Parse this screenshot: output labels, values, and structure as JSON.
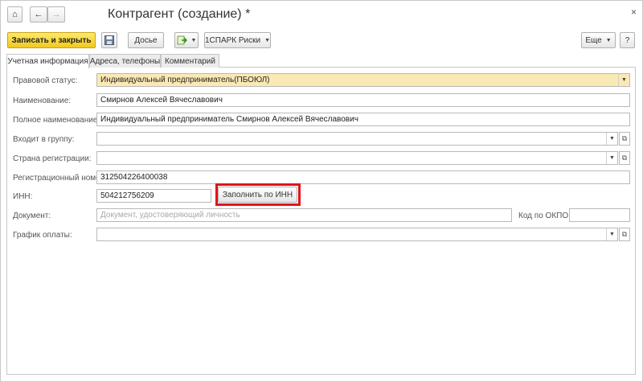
{
  "window": {
    "title": "Контрагент (создание) *",
    "close_glyph": "×"
  },
  "nav": {
    "home_glyph": "⌂",
    "back_glyph": "←",
    "forward_glyph": "→"
  },
  "toolbar": {
    "save_close_label": "Записать и закрыть",
    "dossier_label": "Досье",
    "spark_label": "1СПАРК Риски",
    "more_label": "Еще",
    "help_label": "?"
  },
  "tabs": [
    {
      "label": "Учетная информация",
      "active": true
    },
    {
      "label": "Адреса, телефоны",
      "active": false
    },
    {
      "label": "Комментарий",
      "active": false
    }
  ],
  "form": {
    "legal_status": {
      "label": "Правовой статус:",
      "value": "Индивидуальный предприниматель(ПБОЮЛ)"
    },
    "name": {
      "label": "Наименование:",
      "value": "Смирнов Алексей Вячеславович"
    },
    "full_name": {
      "label": "Полное наименование:",
      "value": "Индивидуальный предприниматель Смирнов Алексей Вячеславович"
    },
    "group": {
      "label": "Входит в группу:",
      "value": ""
    },
    "country": {
      "label": "Страна регистрации:",
      "value": ""
    },
    "reg_number": {
      "label": "Регистрационный номер:",
      "value": "312504226400038"
    },
    "inn": {
      "label": "ИНН:",
      "value": "504212756209"
    },
    "fill_by_inn_label": "Заполнить по ИНН",
    "document": {
      "label": "Документ:",
      "placeholder": "Документ, удостоверяющий личность"
    },
    "okpo": {
      "label": "Код по ОКПО:",
      "value": ""
    },
    "payment_schedule": {
      "label": "График оплаты:",
      "value": ""
    }
  },
  "colors": {
    "primary_button": "#f3c91e",
    "required_field": "#fbe9b5",
    "highlight": "#e3131b"
  }
}
